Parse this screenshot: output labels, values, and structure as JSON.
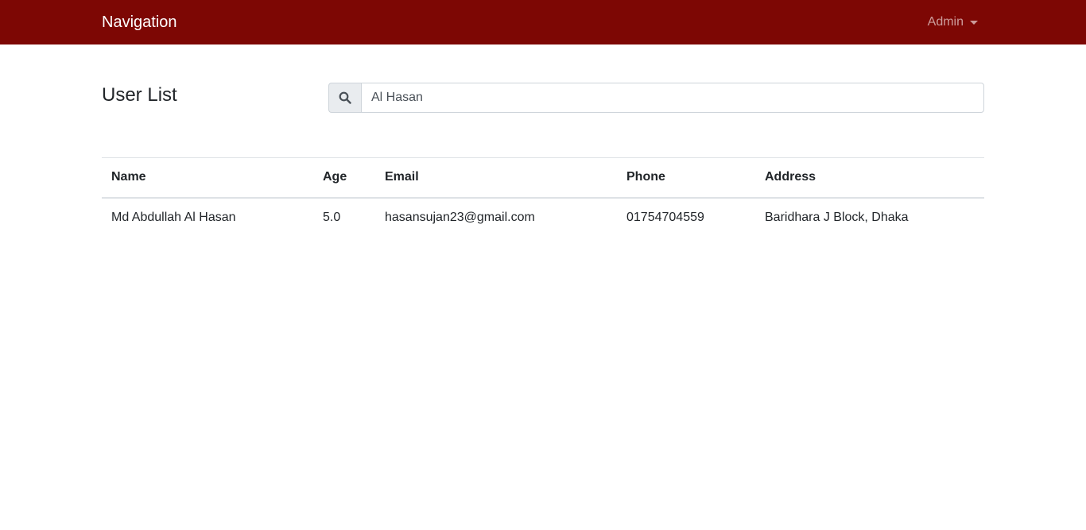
{
  "navbar": {
    "brand": "Navigation",
    "user_menu_label": "Admin",
    "background": "#7d0704"
  },
  "page": {
    "title": "User List"
  },
  "search": {
    "icon": "search-icon",
    "value": "Al Hasan"
  },
  "table": {
    "headers": {
      "name": "Name",
      "age": "Age",
      "email": "Email",
      "phone": "Phone",
      "address": "Address"
    },
    "rows": [
      {
        "name": "Md Abdullah Al Hasan",
        "age": "5.0",
        "email": "hasansujan23@gmail.com",
        "phone": "01754704559",
        "address": "Baridhara J Block, Dhaka"
      }
    ]
  }
}
